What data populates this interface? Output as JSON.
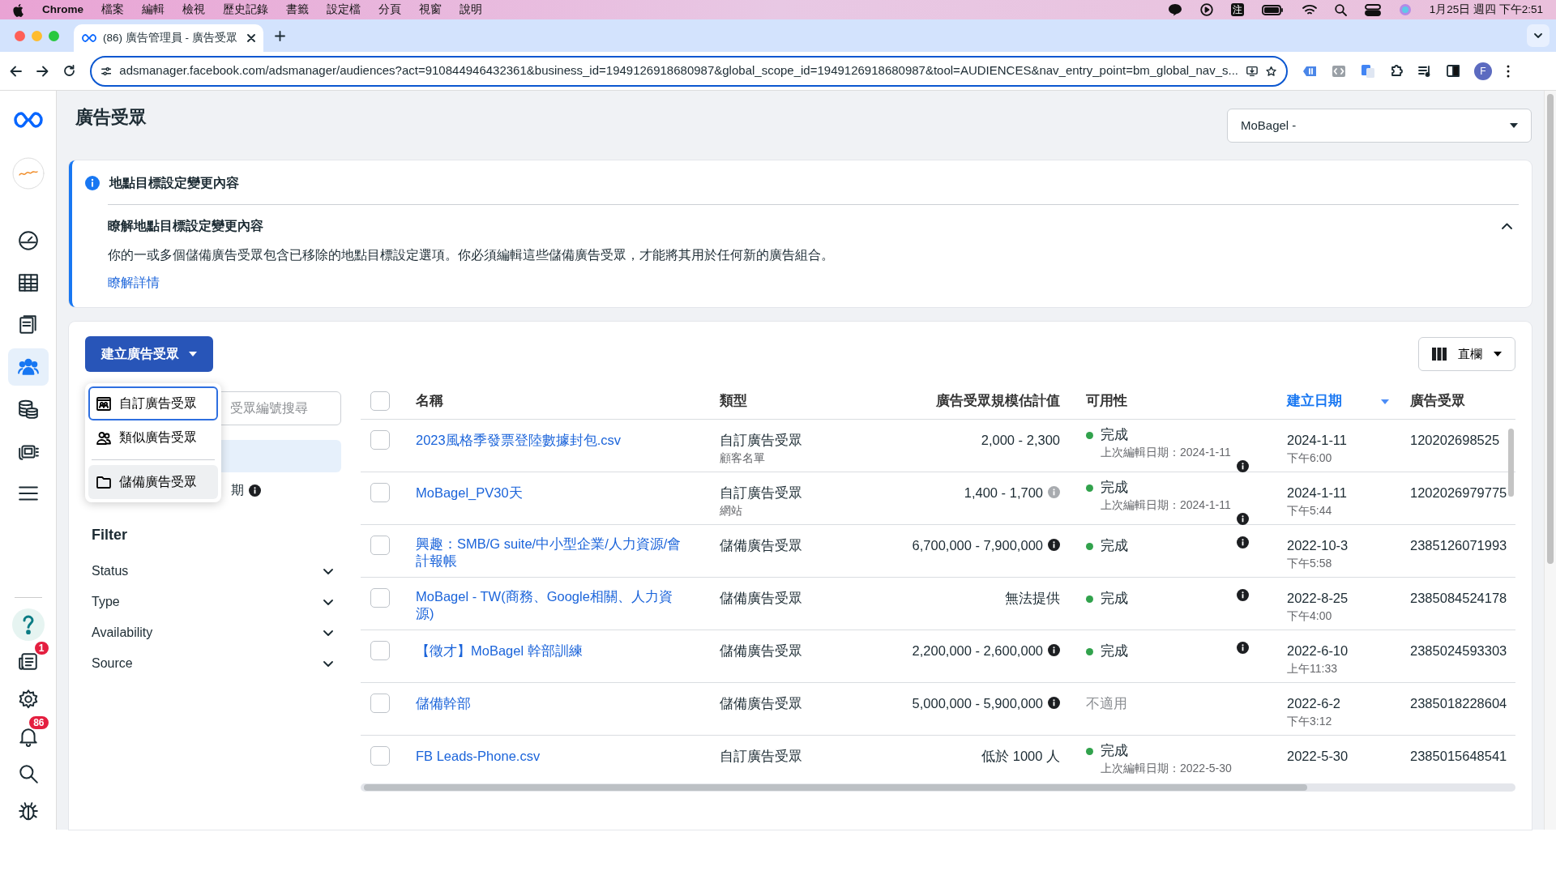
{
  "menubar": {
    "app": "Chrome",
    "menus": [
      "檔案",
      "編輯",
      "檢視",
      "歷史記錄",
      "書籤",
      "設定檔",
      "分頁",
      "視窗",
      "說明"
    ],
    "input_method": "注",
    "clock": "1月25日 週四 下午2:51"
  },
  "browser": {
    "tab": {
      "title": "(86) 廣告管理員 - 廣告受眾",
      "selected": true
    },
    "url": "adsmanager.facebook.com/adsmanager/audiences?act=910844946432361&business_id=1949126918680987&global_scope_id=1949126918680987&tool=AUDIENCES&nav_entry_point=bm_global_nav_s...",
    "profile": "F"
  },
  "rail": {
    "items": [
      {
        "kind": "gauge",
        "selected": false
      },
      {
        "kind": "table",
        "selected": false
      },
      {
        "kind": "pages",
        "selected": false
      },
      {
        "kind": "people",
        "selected": true
      },
      {
        "kind": "database",
        "selected": false
      },
      {
        "kind": "ads",
        "selected": false
      },
      {
        "kind": "menu",
        "selected": false
      }
    ],
    "bottom": [
      {
        "kind": "help"
      },
      {
        "kind": "news",
        "badge": "1"
      },
      {
        "kind": "gear"
      },
      {
        "kind": "bell",
        "badge": "86"
      },
      {
        "kind": "search"
      },
      {
        "kind": "bug"
      }
    ]
  },
  "page": {
    "title": "廣告受眾",
    "account": "MoBagel -"
  },
  "banner": {
    "title": "地點目標設定變更內容",
    "subtitle": "瞭解地點目標設定變更內容",
    "expanded": true,
    "body": "你的一或多個儲備廣告受眾包含已移除的地點目標設定選項。你必須編輯這些儲備廣告受眾，才能將其用於任何新的廣告組合。",
    "link": "瞭解詳情"
  },
  "toolbar": {
    "create_button": "建立廣告受眾",
    "menu_open": true,
    "columns_button": "直欄"
  },
  "create_menu": [
    {
      "label": "自訂廣告受眾",
      "kind": "custom",
      "focused": true,
      "hovered": false
    },
    {
      "label": "類似廣告受眾",
      "kind": "lookalike",
      "focused": false,
      "hovered": false
    },
    {
      "label": "儲備廣告受眾",
      "kind": "saved",
      "focused": false,
      "hovered": true
    }
  ],
  "side": {
    "search": {
      "placeholder": "受眾編號搜尋"
    },
    "items": [
      {
        "selected": true
      },
      {
        "label": "期",
        "selected": false
      }
    ]
  },
  "filter": {
    "title": "Filter",
    "items": [
      {
        "label": "Status",
        "expanded": false
      },
      {
        "label": "Type",
        "expanded": false
      },
      {
        "label": "Availability",
        "expanded": false
      },
      {
        "label": "Source",
        "expanded": false
      }
    ]
  },
  "table": {
    "all_checked": false,
    "columns": [
      {
        "label": "名稱",
        "sorted": false
      },
      {
        "label": "類型",
        "sorted": false
      },
      {
        "label": "廣告受眾規模估計值",
        "sorted": false
      },
      {
        "label": "可用性",
        "sorted": false
      },
      {
        "label": "建立日期",
        "sorted": true
      },
      {
        "label": "廣告受眾",
        "sorted": false
      }
    ],
    "rows": [
      {
        "checked": false,
        "name": "2023風格季發票登陸數據封包.csv",
        "type": "自訂廣告受眾",
        "type_sub": "顧客名單",
        "size": "2,000 - 2,300",
        "available": true,
        "status": "完成",
        "status_sub": "上次編輯日期：2024-1-11",
        "status_info": true,
        "date": "2024-1-11",
        "time": "下午6:00",
        "id": "120202698525"
      },
      {
        "checked": false,
        "name": "MoBagel_PV30天",
        "type": "自訂廣告受眾",
        "type_sub": "網站",
        "size": "1,400 - 1,700",
        "size_info": true,
        "size_info_faint": true,
        "available": true,
        "status": "完成",
        "status_sub": "上次編輯日期：2024-1-11",
        "status_info": true,
        "date": "2024-1-11",
        "time": "下午5:44",
        "id": "1202026979775"
      },
      {
        "checked": false,
        "name": "興趣：SMB/G suite/中小型企業/人力資源/會計報帳",
        "type": "儲備廣告受眾",
        "size": "6,700,000 - 7,900,000",
        "size_info": true,
        "available": true,
        "status": "完成",
        "status_info": true,
        "date": "2022-10-3",
        "time": "下午5:58",
        "id": "2385126071993"
      },
      {
        "checked": false,
        "name": "MoBagel - TW(商務、Google相關、人力資源)",
        "type": "儲備廣告受眾",
        "size": "無法提供",
        "available": true,
        "status": "完成",
        "status_info": true,
        "date": "2022-8-25",
        "time": "下午4:00",
        "id": "2385084524178"
      },
      {
        "checked": false,
        "name": "【徵才】MoBagel 幹部訓練",
        "type": "儲備廣告受眾",
        "size": "2,200,000 - 2,600,000",
        "size_info": true,
        "available": true,
        "status": "完成",
        "status_info": true,
        "date": "2022-6-10",
        "time": "上午11:33",
        "id": "2385024593303"
      },
      {
        "checked": false,
        "name": "儲備幹部",
        "type": "儲備廣告受眾",
        "size": "5,000,000 - 5,900,000",
        "size_info": true,
        "available": false,
        "status": "不適用",
        "date": "2022-6-2",
        "time": "下午3:12",
        "id": "2385018228604"
      },
      {
        "checked": false,
        "name": "FB Leads-Phone.csv",
        "type": "自訂廣告受眾",
        "size": "低於 1000 人",
        "available": true,
        "status": "完成",
        "status_sub": "上次編輯日期：2022-5-30",
        "date": "2022-5-30",
        "id": "2385015648541"
      }
    ]
  }
}
